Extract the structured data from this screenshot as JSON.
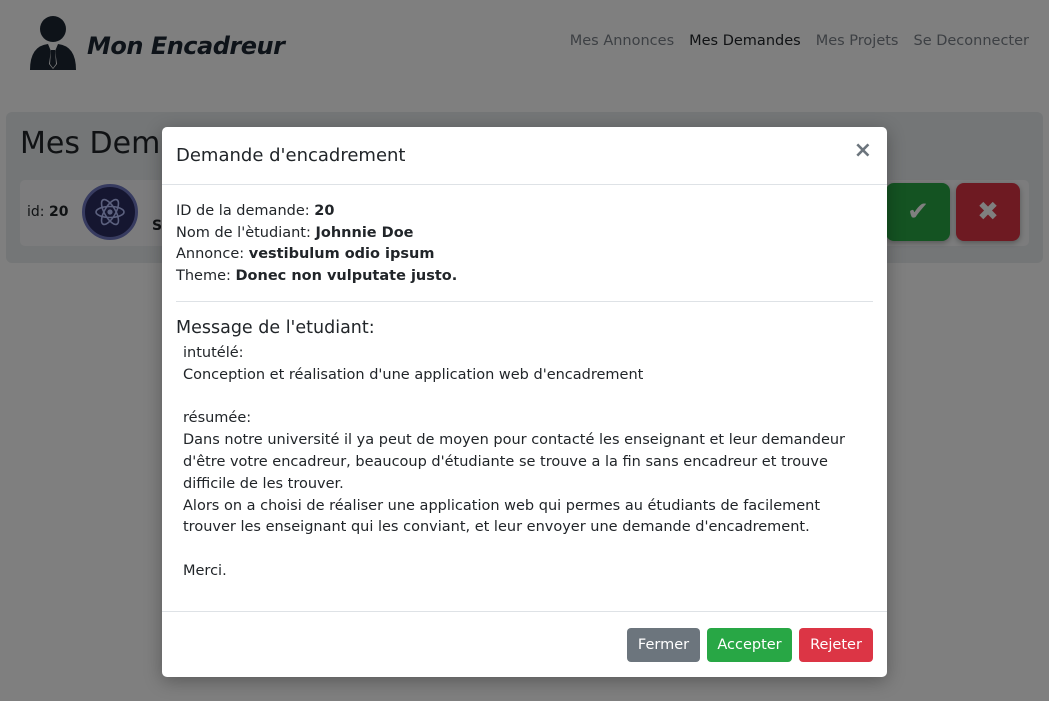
{
  "brand": {
    "name": "Mon Encadreur"
  },
  "nav": {
    "items": [
      {
        "label": "Mes Annonces",
        "active": false
      },
      {
        "label": "Mes Demandes",
        "active": true
      },
      {
        "label": "Mes Projets",
        "active": false
      },
      {
        "label": "Se Deconnecter",
        "active": false
      }
    ]
  },
  "page": {
    "title": "Mes Demandes",
    "request": {
      "id_label": "id:",
      "id_value": "20",
      "name_fragment": "S",
      "accept_icon": "check-icon",
      "reject_icon": "x-icon"
    }
  },
  "modal": {
    "title": "Demande d'encadrement",
    "close_symbol": "×",
    "fields": [
      {
        "label": "ID de la demande: ",
        "value": "20"
      },
      {
        "label": "Nom de l'ètudiant: ",
        "value": "Johnnie Doe"
      },
      {
        "label": "Annonce: ",
        "value": "vestibulum odio ipsum"
      },
      {
        "label": "Theme: ",
        "value": "Donec non vulputate justo."
      }
    ],
    "message_title": "Message de l'etudiant:",
    "message_lines": [
      "intutélé:",
      "Conception et réalisation d'une application web d'encadrement",
      "",
      "résumée:",
      "Dans notre université il ya peut de moyen pour contacté les enseignant et leur demandeur d'être votre encadreur, beaucoup d'étudiante se trouve a la fin sans encadreur et trouve difficile de les trouver.",
      "Alors on a choisi de réaliser une application web qui permes au étudiants de facilement trouver les enseignant qui les conviant, et leur envoyer une demande d'encadrement.",
      "",
      "Merci."
    ],
    "buttons": {
      "close": "Fermer",
      "accept": "Accepter",
      "reject": "Rejeter"
    }
  },
  "colors": {
    "accept": "#28a745",
    "reject": "#dc3545",
    "secondary": "#6c757d"
  }
}
